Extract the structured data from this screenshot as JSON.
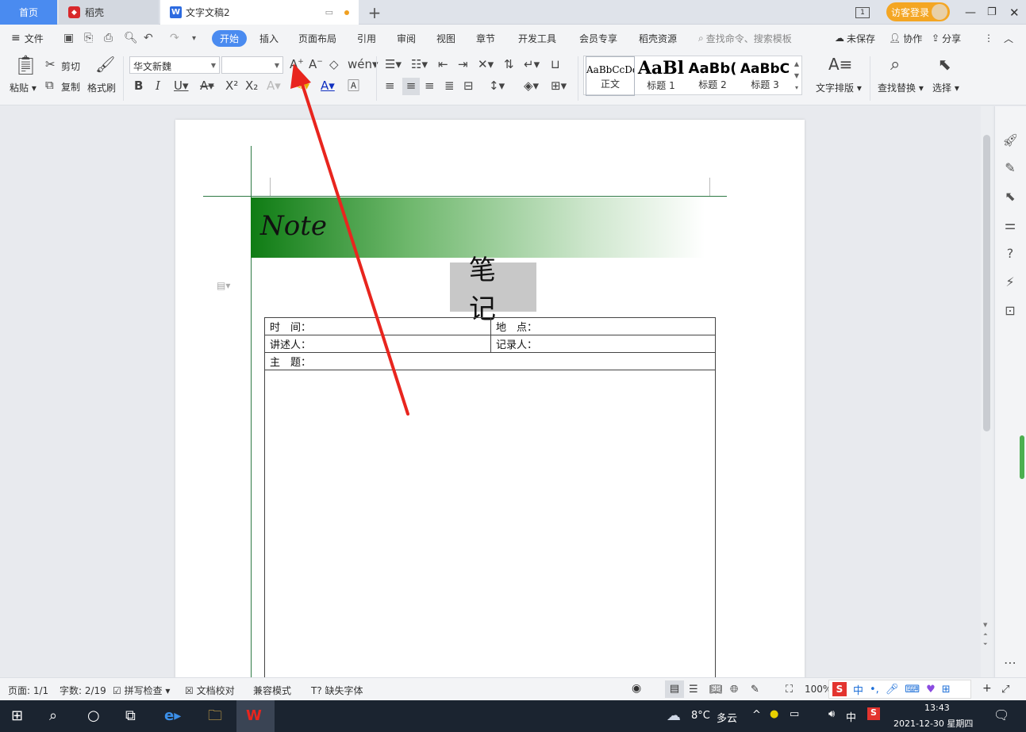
{
  "titlebar": {
    "tab_home": "首页",
    "tab_daoke": "稻壳",
    "tab_doc": "文字文稿2",
    "visitor_login": "访客登录"
  },
  "menubar": {
    "file": "文件",
    "tabs": [
      "开始",
      "插入",
      "页面布局",
      "引用",
      "审阅",
      "视图",
      "章节",
      "开发工具",
      "会员专享",
      "稻壳资源"
    ],
    "search_placeholder": "查找命令、搜索模板",
    "unsaved": "未保存",
    "collab": "协作",
    "share": "分享"
  },
  "ribbon": {
    "paste": "粘贴",
    "cut": "剪切",
    "copy": "复制",
    "format_painter": "格式刷",
    "font_name": "华文新魏",
    "font_size": "",
    "styles": [
      {
        "sample": "AaBbCcDd",
        "name": "正文"
      },
      {
        "sample": "AaBl",
        "name": "标题 1"
      },
      {
        "sample": "AaBb(",
        "name": "标题 2"
      },
      {
        "sample": "AaBbC",
        "name": "标题 3"
      }
    ],
    "text_layout": "文字排版",
    "find_replace": "查找替换",
    "select": "选择"
  },
  "document": {
    "note_banner": "Note",
    "title": "笔记",
    "table": {
      "time": "时　间：",
      "place": "地　点：",
      "speaker": "讲述人：",
      "recorder": "记录人：",
      "topic": "主　题："
    }
  },
  "statusbar": {
    "page": "页面: 1/1",
    "word_count": "字数: 2/19",
    "spell_check": "拼写检查",
    "doc_proof": "文档校对",
    "compat_mode": "兼容模式",
    "missing_font": "缺失字体",
    "zoom": "100%"
  },
  "taskbar": {
    "weather_temp": "8°C",
    "weather_desc": "多云",
    "ime": "中",
    "time": "13:43",
    "date": "2021-12-30 星期四"
  },
  "colors": {
    "accent": "#4a8bf0",
    "note_green": "#0f7c14",
    "annotation_red": "#e8251e"
  }
}
